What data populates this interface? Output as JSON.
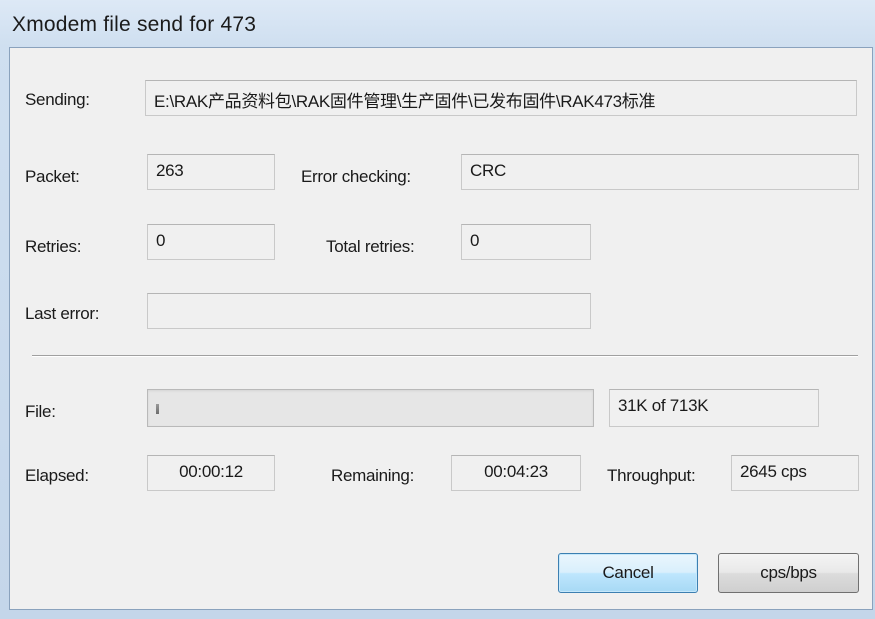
{
  "window": {
    "title": "Xmodem file send for 473"
  },
  "sending": {
    "label": "Sending:",
    "value": "E:\\RAK产品资料包\\RAK固件管理\\生产固件\\已发布固件\\RAK473标准"
  },
  "packet": {
    "label": "Packet:",
    "value": "263"
  },
  "error_checking": {
    "label": "Error checking:",
    "value": "CRC"
  },
  "retries": {
    "label": "Retries:",
    "value": "0"
  },
  "total_retries": {
    "label": "Total retries:",
    "value": "0"
  },
  "last_error": {
    "label": "Last error:",
    "value": ""
  },
  "file": {
    "label": "File:",
    "progress": "31K of 713K",
    "progress_fraction": 0.0435
  },
  "elapsed": {
    "label": "Elapsed:",
    "value": "00:00:12"
  },
  "remaining": {
    "label": "Remaining:",
    "value": "00:04:23"
  },
  "throughput": {
    "label": "Throughput:",
    "value": "2645 cps"
  },
  "buttons": {
    "cancel": "Cancel",
    "cps_bps": "cps/bps"
  },
  "colors": {
    "default_button_border": "#3c7fb1",
    "client_bg": "#f0f0f0",
    "frame": "#cfdff0"
  }
}
